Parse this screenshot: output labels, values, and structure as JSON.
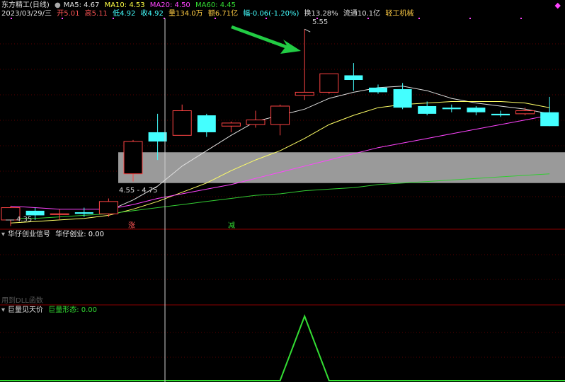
{
  "header": {
    "stock": "东方精工(日线)",
    "ma5": "MA5: 4.67",
    "ma10": "MA10: 4.53",
    "ma20": "MA20: 4.50",
    "ma60": "MA60: 4.45",
    "date": "2023/03/29/三",
    "open": "开5.01",
    "high": "高5.11",
    "low": "低4.92",
    "close": "收4.92",
    "volume": "量134.0万",
    "amount": "额6.71亿",
    "change": "幅-0.06(-1.20%)",
    "turnover": "换13.28%",
    "float": "流通10.1亿",
    "industry": "轻工机械"
  },
  "annotations": {
    "peak": "5.55",
    "low": "4.35",
    "band": "4.55 - 4.75",
    "zhang": "涨",
    "jian": "减"
  },
  "panel2": {
    "title": "华仔创业信号",
    "value": "华仔创业: 0.00",
    "dll_note": "用到DLL函数"
  },
  "panel3": {
    "title": "巨量见天价",
    "value": "巨量形态: 0.00"
  },
  "colors": {
    "up": "#ff4444",
    "down": "#44ffff",
    "ma5": "#e0e0e0",
    "ma10": "#ffff66",
    "ma20": "#ff44ff",
    "ma60": "#33cc33",
    "signal": "#33dd33"
  },
  "chart_data": {
    "type": "candlestick",
    "ylim": [
      4.25,
      5.62
    ],
    "candles": [
      {
        "o": 4.31,
        "h": 4.4,
        "l": 4.27,
        "c": 4.39
      },
      {
        "o": 4.37,
        "h": 4.39,
        "l": 4.31,
        "c": 4.34
      },
      {
        "o": 4.35,
        "h": 4.38,
        "l": 4.31,
        "c": 4.35
      },
      {
        "o": 4.36,
        "h": 4.39,
        "l": 4.33,
        "c": 4.35
      },
      {
        "o": 4.35,
        "h": 4.45,
        "l": 4.33,
        "c": 4.43
      },
      {
        "o": 4.61,
        "h": 4.83,
        "l": 4.56,
        "c": 4.82
      },
      {
        "o": 4.88,
        "h": 5.0,
        "l": 4.7,
        "c": 4.82
      },
      {
        "o": 4.86,
        "h": 5.06,
        "l": 4.86,
        "c": 5.02
      },
      {
        "o": 4.99,
        "h": 5.0,
        "l": 4.85,
        "c": 4.88
      },
      {
        "o": 4.92,
        "h": 4.95,
        "l": 4.88,
        "c": 4.94
      },
      {
        "o": 4.93,
        "h": 5.02,
        "l": 4.91,
        "c": 4.96
      },
      {
        "o": 4.93,
        "h": 5.06,
        "l": 4.86,
        "c": 5.05
      },
      {
        "o": 5.12,
        "h": 5.55,
        "l": 5.09,
        "c": 5.14
      },
      {
        "o": 5.14,
        "h": 5.26,
        "l": 5.13,
        "c": 5.26
      },
      {
        "o": 5.25,
        "h": 5.33,
        "l": 5.15,
        "c": 5.22
      },
      {
        "o": 5.17,
        "h": 5.19,
        "l": 5.13,
        "c": 5.14
      },
      {
        "o": 5.16,
        "h": 5.2,
        "l": 5.03,
        "c": 5.04
      },
      {
        "o": 5.05,
        "h": 5.08,
        "l": 4.99,
        "c": 5.0
      },
      {
        "o": 5.04,
        "h": 5.06,
        "l": 5.01,
        "c": 5.03
      },
      {
        "o": 5.04,
        "h": 5.05,
        "l": 4.99,
        "c": 5.01
      },
      {
        "o": 5.0,
        "h": 5.02,
        "l": 4.98,
        "c": 4.99
      },
      {
        "o": 5.0,
        "h": 5.04,
        "l": 4.99,
        "c": 5.02
      },
      {
        "o": 5.01,
        "h": 5.11,
        "l": 4.92,
        "c": 4.92
      }
    ],
    "ma5": [
      null,
      null,
      null,
      null,
      4.37,
      4.44,
      4.53,
      4.66,
      4.76,
      4.86,
      4.95,
      4.99,
      5.03,
      5.1,
      5.14,
      5.17,
      5.18,
      5.15,
      5.1,
      5.07,
      5.05,
      5.03,
      5.0
    ],
    "ma10": [
      4.29,
      4.3,
      4.31,
      4.32,
      4.34,
      4.38,
      4.43,
      4.49,
      4.55,
      4.63,
      4.7,
      4.76,
      4.84,
      4.93,
      4.99,
      5.04,
      5.06,
      5.07,
      5.08,
      5.08,
      5.08,
      5.07,
      5.04
    ],
    "ma20": [
      4.4,
      4.39,
      4.38,
      4.38,
      4.38,
      4.41,
      4.45,
      4.48,
      4.51,
      4.54,
      4.58,
      4.62,
      4.66,
      4.7,
      4.74,
      4.78,
      4.81,
      4.84,
      4.87,
      4.9,
      4.93,
      4.96,
      4.99
    ],
    "ma60": [
      4.32,
      4.32,
      4.33,
      4.34,
      4.35,
      4.37,
      4.39,
      4.41,
      4.43,
      4.45,
      4.47,
      4.48,
      4.5,
      4.51,
      4.52,
      4.54,
      4.55,
      4.56,
      4.57,
      4.58,
      4.59,
      4.6,
      4.61
    ],
    "band": [
      4.55,
      4.75
    ],
    "signal": [
      0,
      0,
      0,
      0,
      0,
      0,
      0,
      0,
      0,
      0,
      0,
      0,
      1,
      0,
      0,
      0,
      0,
      0,
      0,
      0,
      0,
      0,
      0
    ]
  }
}
